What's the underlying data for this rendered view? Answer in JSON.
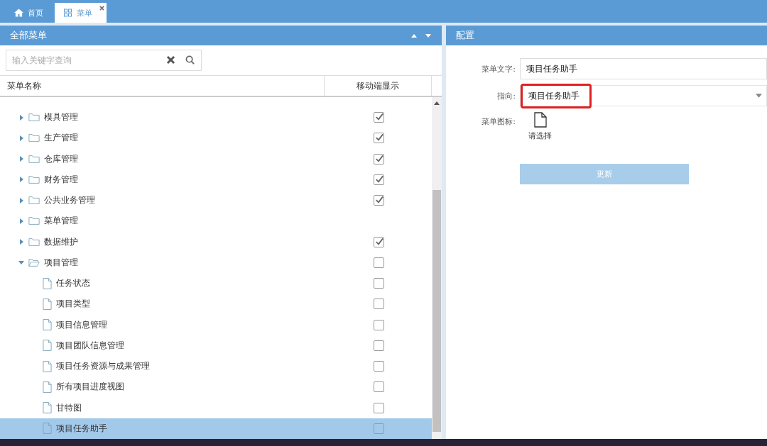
{
  "tabs": [
    {
      "label": "首页",
      "selected": false,
      "closable": false
    },
    {
      "label": "菜单",
      "selected": true,
      "closable": true
    }
  ],
  "left_panel": {
    "title": "全部菜单",
    "search": {
      "placeholder": "输入关键字查询"
    },
    "columns": [
      "菜单名称",
      "移动端显示"
    ],
    "tree": [
      {
        "kind": "folder",
        "label": "模具管理",
        "expanded": false,
        "checked": true,
        "selected": false
      },
      {
        "kind": "folder",
        "label": "生产管理",
        "expanded": false,
        "checked": true,
        "selected": false
      },
      {
        "kind": "folder",
        "label": "仓库管理",
        "expanded": false,
        "checked": true,
        "selected": false
      },
      {
        "kind": "folder",
        "label": "财务管理",
        "expanded": false,
        "checked": true,
        "selected": false
      },
      {
        "kind": "folder",
        "label": "公共业务管理",
        "expanded": false,
        "checked": true,
        "selected": false
      },
      {
        "kind": "folder",
        "label": "菜单管理",
        "expanded": false,
        "selected": false
      },
      {
        "kind": "folder",
        "label": "数据维护",
        "expanded": false,
        "checked": true,
        "selected": false
      },
      {
        "kind": "folder",
        "label": "项目管理",
        "expanded": true,
        "checked": false,
        "selected": false,
        "children": [
          {
            "kind": "file",
            "label": "任务状态",
            "checked": false,
            "selected": false
          },
          {
            "kind": "file",
            "label": "项目类型",
            "checked": false,
            "selected": false
          },
          {
            "kind": "file",
            "label": "项目信息管理",
            "checked": false,
            "selected": false
          },
          {
            "kind": "file",
            "label": "项目团队信息管理",
            "checked": false,
            "selected": false
          },
          {
            "kind": "file",
            "label": "项目任务资源与成果管理",
            "checked": false,
            "selected": false
          },
          {
            "kind": "file",
            "label": "所有项目进度视图",
            "checked": false,
            "selected": false
          },
          {
            "kind": "file",
            "label": "甘特图",
            "checked": false,
            "selected": false
          },
          {
            "kind": "file",
            "label": "项目任务助手",
            "checked": false,
            "selected": true
          }
        ]
      }
    ]
  },
  "right_panel": {
    "title": "配置",
    "menu_text": {
      "label": "菜单文字:",
      "value": "项目任务助手"
    },
    "target": {
      "label": "指向:",
      "value": "项目任务助手",
      "highlighted": true
    },
    "menu_icon": {
      "label": "菜单图标:",
      "hint": "请选择"
    },
    "update_button": "更新"
  }
}
